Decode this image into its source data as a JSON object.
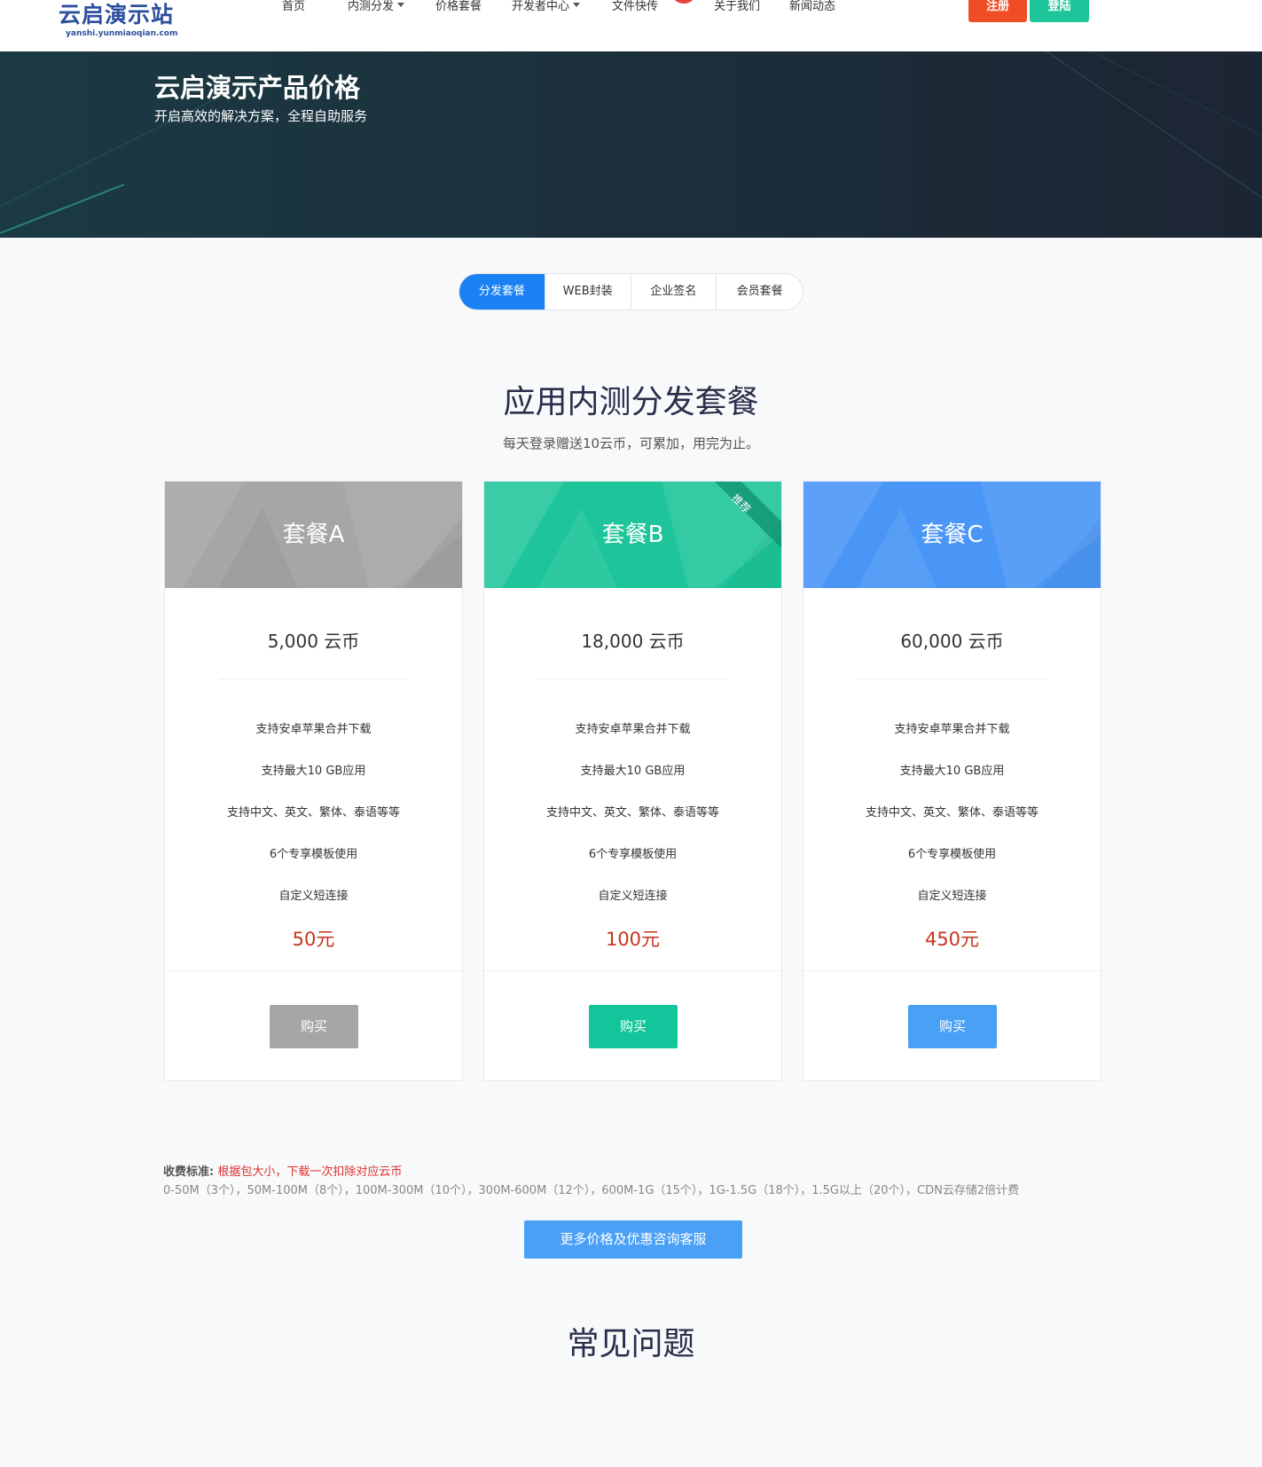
{
  "nav": {
    "logo_main": "云启演示站",
    "logo_sub": "yanshi.yunmiaoqian.com",
    "items": [
      {
        "label": "首页",
        "dropdown": false
      },
      {
        "label": "内测分发",
        "dropdown": true
      },
      {
        "label": "价格套餐",
        "dropdown": false
      },
      {
        "label": "开发者中心",
        "dropdown": true
      },
      {
        "label": "文件快传",
        "dropdown": false
      },
      {
        "label": "关于我们",
        "dropdown": false
      },
      {
        "label": "新闻动态",
        "dropdown": false
      }
    ],
    "register_label": "注册",
    "login_label": "登陆"
  },
  "hero": {
    "title": "云启演示产品价格",
    "subtitle": "开启高效的解决方案，全程自助服务"
  },
  "tabs": [
    {
      "label": "分发套餐",
      "active": true
    },
    {
      "label": "WEB封装",
      "active": false
    },
    {
      "label": "企业签名",
      "active": false
    },
    {
      "label": "会员套餐",
      "active": false
    }
  ],
  "section": {
    "title": "应用内测分发套餐",
    "subtitle": "每天登录赠送10云币，可累加，用完为止。"
  },
  "plans": [
    {
      "name": "套餐A",
      "coins": "5,000 云币",
      "features": [
        "支持安卓苹果合并下载",
        "支持最大10 GB应用",
        "支持中文、英文、繁体、泰语等等",
        "6个专享模板使用",
        "自定义短连接"
      ],
      "price": "50元",
      "buy_label": "购买",
      "badge": "",
      "color": "#a6a6a6"
    },
    {
      "name": "套餐B",
      "coins": "18,000 云币",
      "features": [
        "支持安卓苹果合并下载",
        "支持最大10 GB应用",
        "支持中文、英文、繁体、泰语等等",
        "6个专享模板使用",
        "自定义短连接"
      ],
      "price": "100元",
      "buy_label": "购买",
      "badge": "推荐",
      "color": "#1ec59a"
    },
    {
      "name": "套餐C",
      "coins": "60,000 云币",
      "features": [
        "支持安卓苹果合并下载",
        "支持最大10 GB应用",
        "支持中文、英文、繁体、泰语等等",
        "6个专享模板使用",
        "自定义短连接"
      ],
      "price": "450元",
      "buy_label": "购买",
      "badge": "",
      "color": "#4a96f6"
    }
  ],
  "fee": {
    "label": "收费标准:",
    "rule": "根据包大小，下载一次扣除对应云币",
    "tiers": "0-50M（3个），50M-100M（8个），100M-300M（10个），300M-600M（12个），600M-1G（15个），1G-1.5G（18个），1.5G以上（20个），CDN云存储2倍计费"
  },
  "more_button": "更多价格及优惠咨询客服",
  "faq_title": "常见问题",
  "colors": {
    "accent_blue": "#1a82f2",
    "register_red": "#f04d26",
    "login_green": "#1ec59a",
    "price_red": "#c4361e"
  }
}
